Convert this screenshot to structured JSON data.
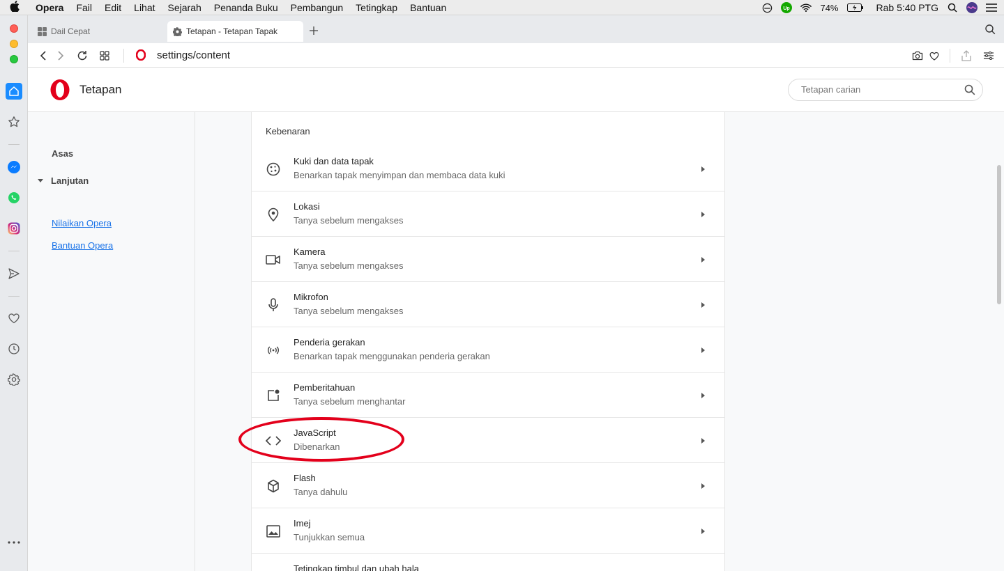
{
  "menubar": {
    "app": "Opera",
    "items": [
      "Fail",
      "Edit",
      "Lihat",
      "Sejarah",
      "Penanda Buku",
      "Pembangun",
      "Tetingkap",
      "Bantuan"
    ],
    "battery": "74%",
    "clock": "Rab 5:40 PTG"
  },
  "tabs": [
    {
      "label": "Dail Cepat"
    },
    {
      "label": "Tetapan - Tetapan Tapak"
    }
  ],
  "toolbar": {
    "url": "settings/content"
  },
  "header": {
    "title": "Tetapan",
    "search_placeholder": "Tetapan carian"
  },
  "nav": {
    "basic": "Asas",
    "advanced": "Lanjutan",
    "links": [
      "Nilaikan Opera",
      "Bantuan Opera"
    ]
  },
  "content": {
    "section_title": "Kebenaran",
    "rows": [
      {
        "title": "Kuki dan data tapak",
        "subtitle": "Benarkan tapak menyimpan dan membaca data kuki",
        "icon": "cookie-icon"
      },
      {
        "title": "Lokasi",
        "subtitle": "Tanya sebelum mengakses",
        "icon": "location-pin-icon"
      },
      {
        "title": "Kamera",
        "subtitle": "Tanya sebelum mengakses",
        "icon": "camera-icon"
      },
      {
        "title": "Mikrofon",
        "subtitle": "Tanya sebelum mengakses",
        "icon": "microphone-icon"
      },
      {
        "title": "Penderia gerakan",
        "subtitle": "Benarkan tapak menggunakan penderia gerakan",
        "icon": "motion-sensor-icon"
      },
      {
        "title": "Pemberitahuan",
        "subtitle": "Tanya sebelum menghantar",
        "icon": "notification-icon"
      },
      {
        "title": "JavaScript",
        "subtitle": "Dibenarkan",
        "icon": "code-icon"
      },
      {
        "title": "Flash",
        "subtitle": "Tanya dahulu",
        "icon": "flash-box-icon"
      },
      {
        "title": "Imej",
        "subtitle": "Tunjukkan semua",
        "icon": "image-icon"
      },
      {
        "title": "Tetingkap timbul dan ubah hala",
        "subtitle": "",
        "icon": "popup-icon"
      }
    ]
  },
  "colors": {
    "accent": "#1a8cff",
    "opera_red": "#e3001b",
    "link": "#1a73e8",
    "highlight_ring": "#e3001b"
  }
}
